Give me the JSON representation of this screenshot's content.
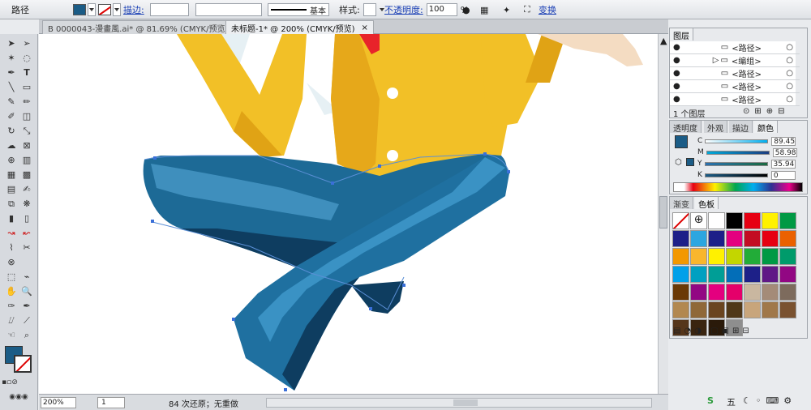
{
  "control_bar": {
    "object_label": "路径",
    "fill_color": "#1b5c86",
    "stroke_label": "描边:",
    "stroke_style": "基本",
    "style_label": "样式:",
    "opacity_label": "不透明度:",
    "opacity_value": "100",
    "percent": "%",
    "transform_label": "变换"
  },
  "tabs": [
    {
      "label": "B 0000043-漫畫風.ai* @ 81.69% (CMYK/预览)",
      "close": "×"
    },
    {
      "label": "未标题-1* @ 200% (CMYK/预览)",
      "close": "×"
    }
  ],
  "status_bar": {
    "zoom": "200%",
    "artboard": "1",
    "status_text": "84 次还原；无重做"
  },
  "layers_panel": {
    "tab": "图层",
    "rows": [
      "<路径>",
      "<编组>",
      "<路径>",
      "<路径>",
      "<路径>"
    ],
    "footer": "1 个图层"
  },
  "color_panel": {
    "tabs": [
      "透明度",
      "外观",
      "描边",
      "颜色"
    ],
    "sliders": [
      {
        "label": "C",
        "value": "89.45"
      },
      {
        "label": "M",
        "value": "58.98"
      },
      {
        "label": "Y",
        "value": "35.94"
      },
      {
        "label": "K",
        "value": "0"
      }
    ]
  },
  "swatches_panel": {
    "tabs": [
      "渐变",
      "色板"
    ],
    "colors": [
      "#ffffff",
      "#000000",
      "#e60012",
      "#fff100",
      "#009944",
      "#1d2088",
      "#2ca6e0",
      "#1d2088",
      "#e4007f",
      "#c30d23",
      "#e60012",
      "#eb6100",
      "#f39800",
      "#f8b62d",
      "#fff100",
      "#c3d600",
      "#22ac38",
      "#009944",
      "#009b6b",
      "#00a0e9",
      "#00a0c1",
      "#009e96",
      "#036eb8",
      "#1d2088",
      "#601986",
      "#920783",
      "#6a3906",
      "#920783",
      "#e4007f",
      "#e5006a",
      "#c9b7a0",
      "#a48b78",
      "#7d6b5d",
      "#b28850",
      "#8f6838",
      "#6a4520",
      "#503818",
      "#c8a57b",
      "#a0784a",
      "#7a5230",
      "#55351a",
      "#3a2510",
      "#2a1a0a",
      "#8e8e8e"
    ]
  },
  "taskbar": {
    "ime": "五"
  }
}
